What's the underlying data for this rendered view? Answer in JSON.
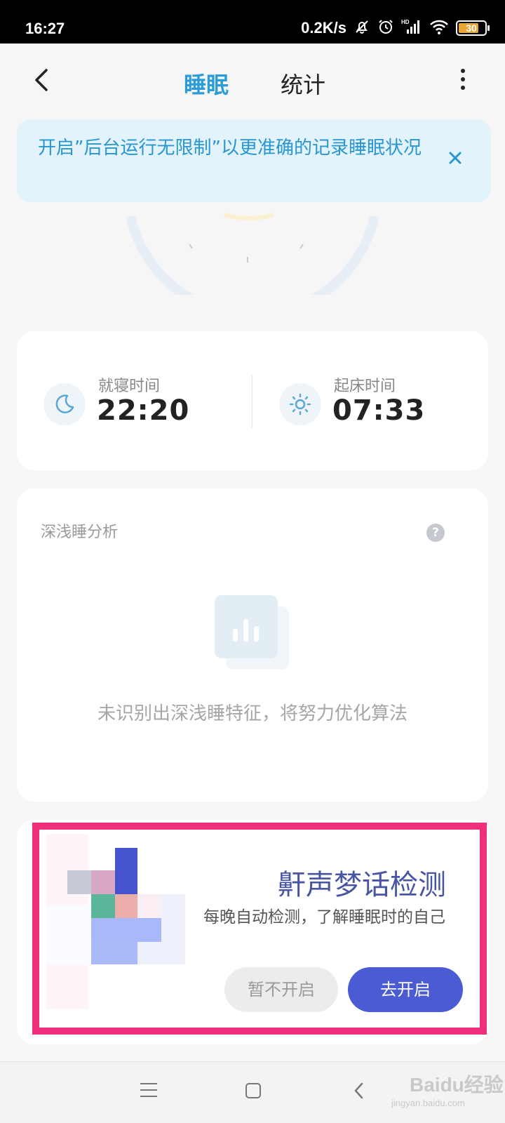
{
  "status_bar": {
    "time": "16:27",
    "net_speed": "0.2K/s",
    "battery": "30",
    "icons": [
      "mute-bell-icon",
      "alarm-icon",
      "hd-signal-icon",
      "wifi-icon",
      "battery-icon"
    ]
  },
  "header": {
    "tabs": [
      {
        "label": "睡眠",
        "active": true
      },
      {
        "label": "统计",
        "active": false
      }
    ]
  },
  "banner": {
    "text": "开启”后台运行无限制”以更准确的记录睡眠状况"
  },
  "sleep_times": {
    "bedtime_label": "就寝时间",
    "bedtime_value": "22:20",
    "wake_label": "起床时间",
    "wake_value": "07:33"
  },
  "analysis": {
    "title": "深浅睡分析",
    "help": "?",
    "empty_text": "未识别出深浅睡特征，将努力优化算法"
  },
  "promo": {
    "title": "鼾声梦话检测",
    "description": "每晚自动检测，了解睡眠时的自己",
    "later_label": "暂不开启",
    "go_label": "去开启"
  },
  "watermark": {
    "brand": "Baidu经验",
    "url": "jingyan.baidu.com"
  },
  "colors": {
    "accent": "#2b9cd8",
    "banner_bg": "#e2f3fb",
    "primary_button": "#4a5bd4",
    "highlight": "#ef2f7c"
  }
}
